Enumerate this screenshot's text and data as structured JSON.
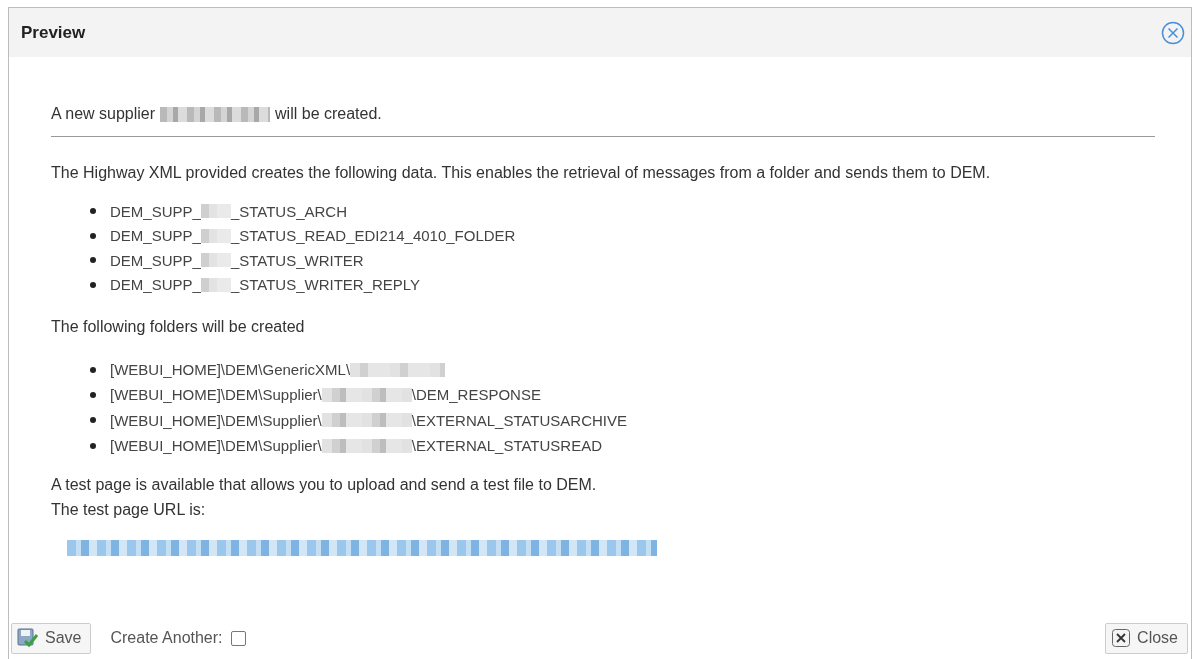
{
  "dialog": {
    "title": "Preview"
  },
  "intro": [
    {
      "kind": "text",
      "text": "A new supplier"
    },
    {
      "kind": "redacted"
    },
    {
      "kind": "text",
      "text": "will be created."
    }
  ],
  "description": "The Highway XML provided creates the following data. This enables the retrieval of messages from a folder and sends them to DEM.",
  "data_items": [
    [
      {
        "kind": "text",
        "text": "DEM_SUPP_"
      },
      {
        "kind": "redacted"
      },
      {
        "kind": "text",
        "text": "_STATUS_ARCH"
      }
    ],
    [
      {
        "kind": "text",
        "text": "DEM_SUPP_"
      },
      {
        "kind": "redacted"
      },
      {
        "kind": "text",
        "text": "_STATUS_READ_EDI214_4010_FOLDER"
      }
    ],
    [
      {
        "kind": "text",
        "text": "DEM_SUPP_"
      },
      {
        "kind": "redacted"
      },
      {
        "kind": "text",
        "text": "_STATUS_WRITER"
      }
    ],
    [
      {
        "kind": "text",
        "text": "DEM_SUPP_"
      },
      {
        "kind": "redacted"
      },
      {
        "kind": "text",
        "text": "_STATUS_WRITER_REPLY"
      }
    ]
  ],
  "folders_heading": "The following folders will be created",
  "folders": [
    [
      {
        "kind": "text",
        "text": "[WEBUI_HOME]\\DEM\\GenericXML\\"
      },
      {
        "kind": "redacted"
      }
    ],
    [
      {
        "kind": "text",
        "text": "[WEBUI_HOME]\\DEM\\Supplier\\"
      },
      {
        "kind": "redacted"
      },
      {
        "kind": "text",
        "text": "\\DEM_RESPONSE"
      }
    ],
    [
      {
        "kind": "text",
        "text": "[WEBUI_HOME]\\DEM\\Supplier\\"
      },
      {
        "kind": "redacted"
      },
      {
        "kind": "text",
        "text": "\\EXTERNAL_STATUSARCHIVE"
      }
    ],
    [
      {
        "kind": "text",
        "text": "[WEBUI_HOME]\\DEM\\Supplier\\"
      },
      {
        "kind": "redacted"
      },
      {
        "kind": "text",
        "text": "\\EXTERNAL_STATUSREAD"
      }
    ]
  ],
  "test_page_lines": [
    "A test page is available that allows you to upload and send a test file to DEM.",
    "The test page URL is:"
  ],
  "test_url": {
    "kind": "redacted"
  },
  "footer": {
    "save": "Save",
    "create_another": {
      "label": "Create Another:",
      "checked": false
    },
    "close": "Close"
  }
}
